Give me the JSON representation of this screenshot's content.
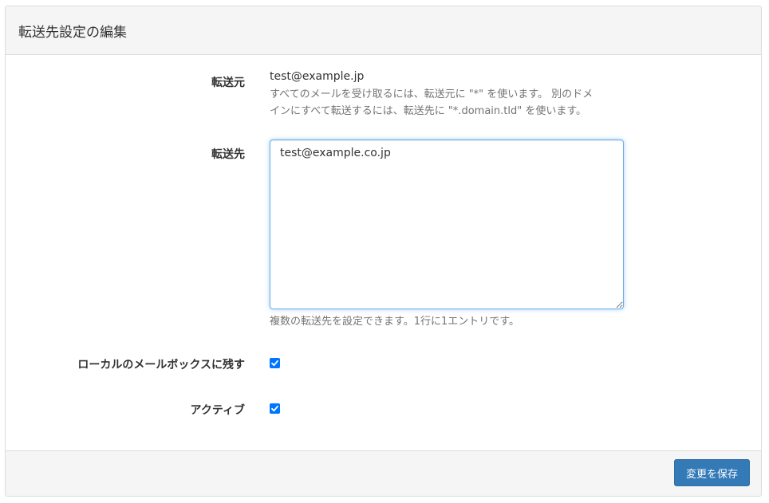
{
  "page": {
    "title": "転送先設定の編集"
  },
  "form": {
    "source_label": "転送元",
    "source_value": "test@example.jp",
    "source_help_line1": "すべてのメールを受け取るには、転送元に \"*\" を使います。 別のドメ",
    "source_help_line2": "インにすべて転送するには、転送先に \"*.domain.tld\" を使います。",
    "dest_label": "転送先",
    "dest_value": "test@example.co.jp",
    "dest_help": "複数の転送先を設定できます。1行に1エントリです。",
    "keep_local_label": "ローカルのメールボックスに残す",
    "keep_local_checked": true,
    "active_label": "アクティブ",
    "active_checked": true,
    "checkbox_color": "#0075ff"
  },
  "footer": {
    "save_label": "変更を保存",
    "save_color": "#337ab7"
  }
}
